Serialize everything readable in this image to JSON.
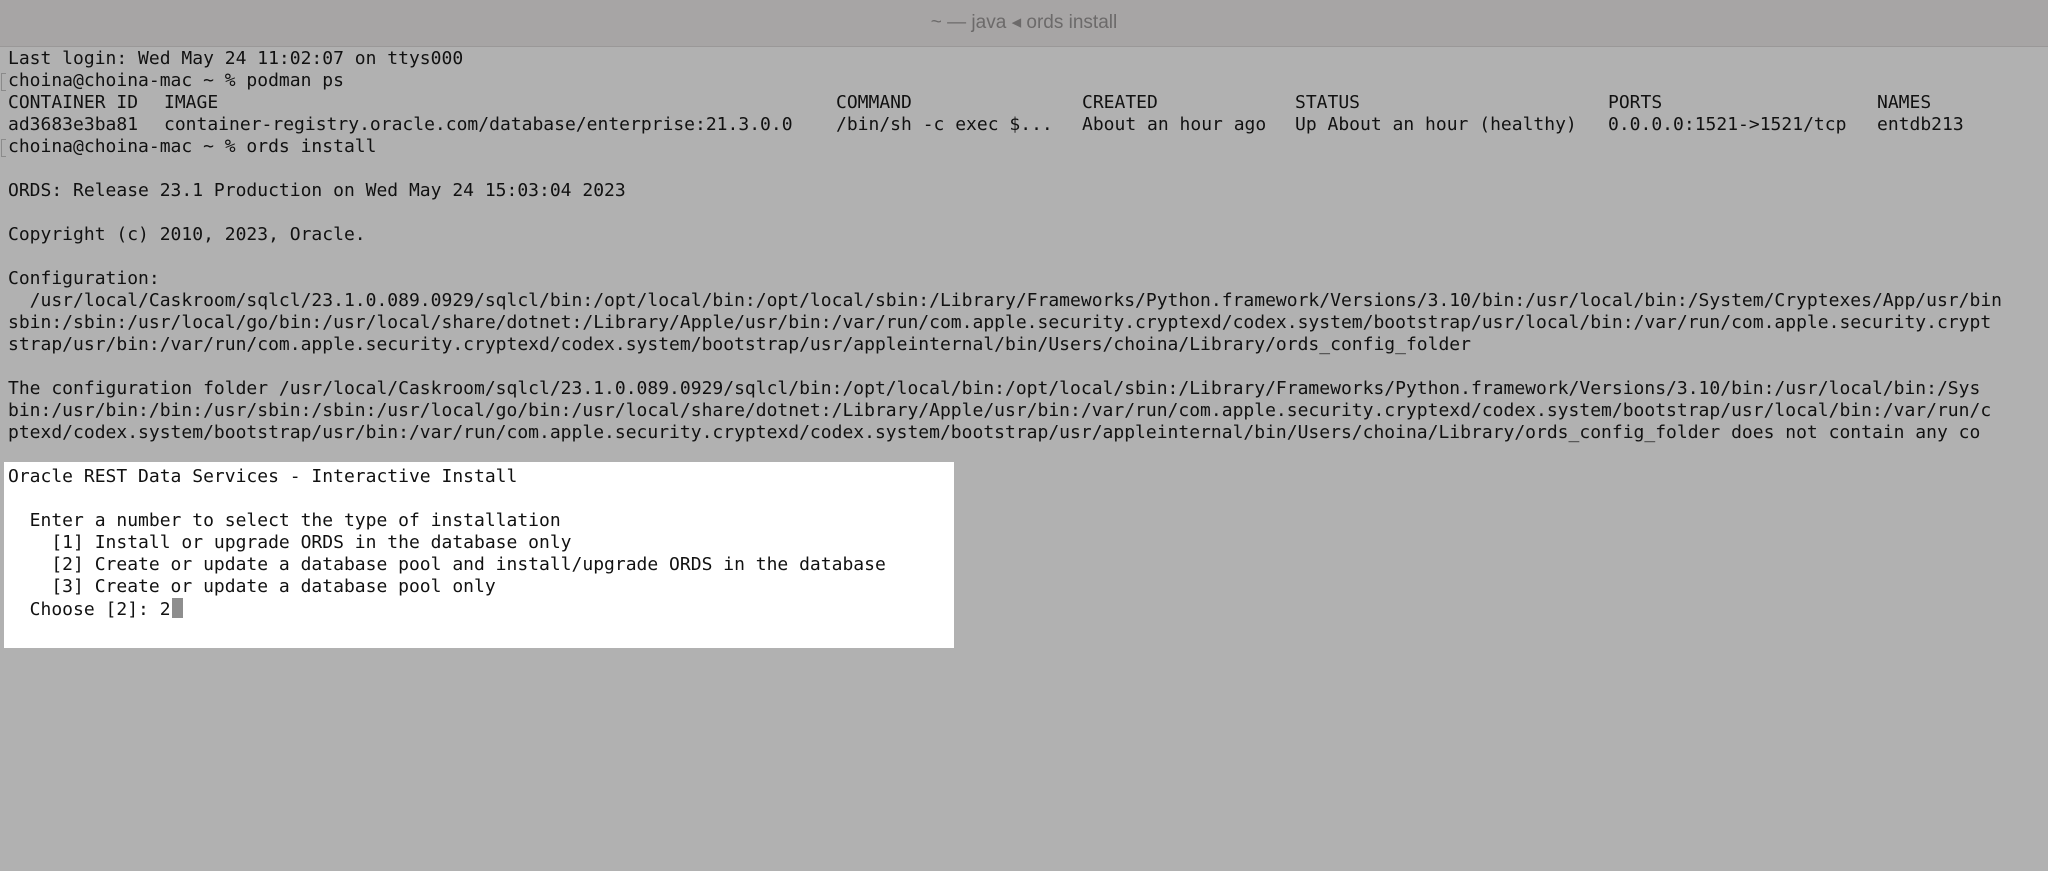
{
  "window": {
    "title": "~ — java ◂ ords install"
  },
  "terminal": {
    "last_login": "Last login: Wed May 24 11:02:07 on ttys000",
    "prompt1": "choina@choina-mac ~ % podman ps",
    "table": {
      "headers": [
        "CONTAINER ID",
        "IMAGE",
        "COMMAND",
        "CREATED",
        "STATUS",
        "PORTS",
        "NAMES"
      ],
      "rows": [
        [
          "ad3683e3ba81",
          "container-registry.oracle.com/database/enterprise:21.3.0.0",
          "/bin/sh -c exec $...",
          "About an hour ago",
          "Up About an hour (healthy)",
          "0.0.0.0:1521->1521/tcp",
          "entdb213"
        ]
      ]
    },
    "prompt2": "choina@choina-mac ~ % ords install",
    "release": "ORDS: Release 23.1 Production on Wed May 24 15:03:04 2023",
    "copyright": "Copyright (c) 2010, 2023, Oracle.",
    "config_label": "Configuration:",
    "config_line1": "  /usr/local/Caskroom/sqlcl/23.1.0.089.0929/sqlcl/bin:/opt/local/bin:/opt/local/sbin:/Library/Frameworks/Python.framework/Versions/3.10/bin:/usr/local/bin:/System/Cryptexes/App/usr/bin",
    "config_line2": "sbin:/sbin:/usr/local/go/bin:/usr/local/share/dotnet:/Library/Apple/usr/bin:/var/run/com.apple.security.cryptexd/codex.system/bootstrap/usr/local/bin:/var/run/com.apple.security.crypt",
    "config_line3": "strap/usr/bin:/var/run/com.apple.security.cryptexd/codex.system/bootstrap/usr/appleinternal/bin/Users/choina/Library/ords_config_folder",
    "folder_line1": "The configuration folder /usr/local/Caskroom/sqlcl/23.1.0.089.0929/sqlcl/bin:/opt/local/bin:/opt/local/sbin:/Library/Frameworks/Python.framework/Versions/3.10/bin:/usr/local/bin:/Sys",
    "folder_line2": "bin:/usr/bin:/bin:/usr/sbin:/sbin:/usr/local/go/bin:/usr/local/share/dotnet:/Library/Apple/usr/bin:/var/run/com.apple.security.cryptexd/codex.system/bootstrap/usr/local/bin:/var/run/c",
    "folder_line3": "ptexd/codex.system/bootstrap/usr/bin:/var/run/com.apple.security.cryptexd/codex.system/bootstrap/usr/appleinternal/bin/Users/choina/Library/ords_config_folder does not contain any co",
    "install": {
      "heading": "Oracle REST Data Services - Interactive Install",
      "instruction": "  Enter a number to select the type of installation",
      "option1": "    [1] Install or upgrade ORDS in the database only",
      "option2": "    [2] Create or update a database pool and install/upgrade ORDS in the database",
      "option3": "    [3] Create or update a database pool only",
      "choose_prompt": "  Choose [2]: ",
      "choose_value": "2"
    }
  }
}
